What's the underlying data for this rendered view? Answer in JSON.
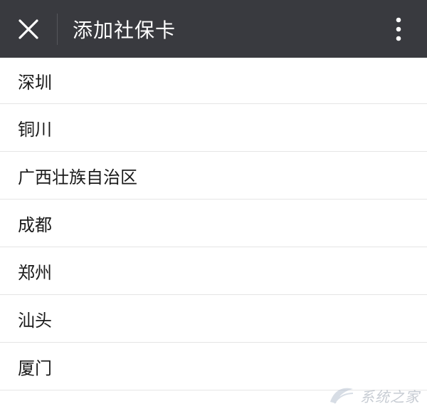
{
  "header": {
    "title": "添加社保卡",
    "close_icon": "close-icon",
    "more_icon": "more-vertical-icon",
    "background_color": "#393a3f"
  },
  "cities": [
    {
      "label": "深圳"
    },
    {
      "label": "铜川"
    },
    {
      "label": "广西壮族自治区"
    },
    {
      "label": "成都"
    },
    {
      "label": "郑州"
    },
    {
      "label": "汕头"
    },
    {
      "label": "厦门"
    }
  ],
  "watermark": {
    "text": "系统之家"
  }
}
